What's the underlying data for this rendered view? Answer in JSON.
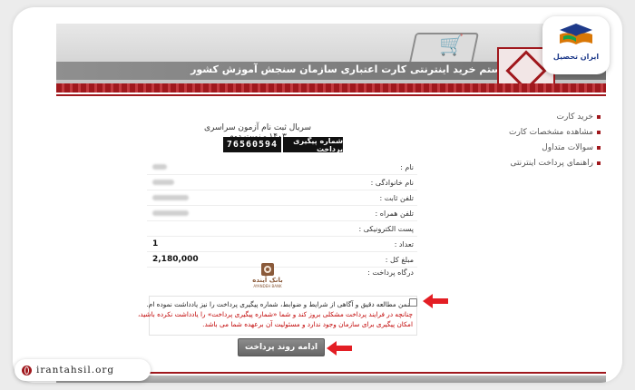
{
  "header": {
    "title": "سیستم خرید اینترنتی کارت اعتباری سازمان سنجش آموزش کشور"
  },
  "sidebar": {
    "items": [
      {
        "label": "خرید کارت"
      },
      {
        "label": "مشاهده مشخصات کارت"
      },
      {
        "label": "سوالات متداول"
      },
      {
        "label": "راهنمای پرداخت اینترنتی"
      }
    ]
  },
  "order": {
    "exam_title": "سریال ثبت نام آزمون سراسری ۱۴۰۳ - نوبت دوم",
    "tracking_label": "شماره پیگیری پرداخت",
    "tracking_number": "76560594"
  },
  "form": {
    "fields": [
      {
        "label": "نام :",
        "value": ""
      },
      {
        "label": "نام خانوادگی :",
        "value": ""
      },
      {
        "label": "تلفن ثابت :",
        "value": ""
      },
      {
        "label": "تلفن همراه :",
        "value": ""
      },
      {
        "label": "پست الکترونیکی :",
        "value": ""
      },
      {
        "label": "تعداد :",
        "value": "1"
      },
      {
        "label": "مبلغ کل :",
        "value": "2,180,000"
      }
    ],
    "gateway_label": "درگاه پرداخت :",
    "bank_name": "بانک آینده",
    "bank_sub": "AYANDEH BANK"
  },
  "terms": {
    "agree_text": "ضمن مطالعه دقیق و آگاهی از شرایط و ضوابط، شماره پیگیری پرداخت را نیز یادداشت نموده ام.",
    "warning_line1": "چنانچه در فرایند پرداخت مشکلی بروز کند و شما «شماره پیگیری پرداخت» را یادداشت نکرده باشید،",
    "warning_line2": "امکان پیگیری برای سازمان وجود ندارد و مسئولیت آن برعهده شما می باشد.",
    "checked": false
  },
  "actions": {
    "continue_label": "ادامه روند پرداخت"
  },
  "branding": {
    "name": "ایران تحصیل",
    "site": "irantahsil.org"
  },
  "colors": {
    "accent": "#a0181d",
    "warning": "#c00000",
    "arrow": "#e31e24"
  }
}
